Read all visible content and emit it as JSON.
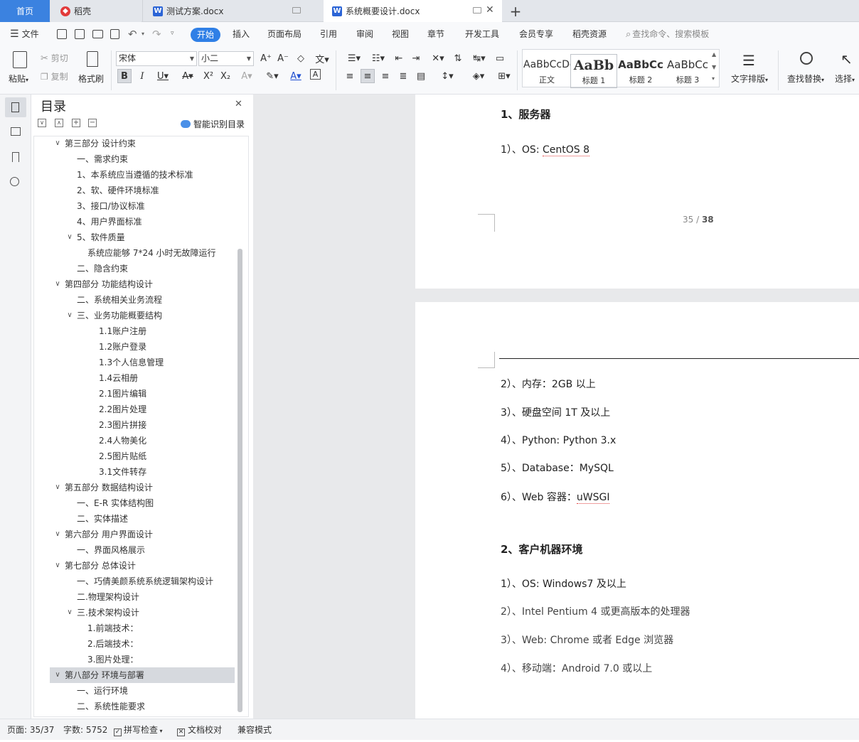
{
  "tabs": {
    "home": "首页",
    "daoke": "稻壳",
    "doc1": "测试方案.docx",
    "doc2": "系统概要设计.docx",
    "new_tab": "+"
  },
  "menu": {
    "file": "文件",
    "items": [
      "开始",
      "插入",
      "页面布局",
      "引用",
      "审阅",
      "视图",
      "章节",
      "开发工具",
      "会员专享",
      "稻壳资源"
    ],
    "search_placeholder": "查找命令、搜索模板"
  },
  "ribbon": {
    "paste": "粘贴",
    "cut": "剪切",
    "copy": "复制",
    "format_painter": "格式刷",
    "font_name": "宋体",
    "font_size": "小二",
    "styles": [
      {
        "sample": "AaBbCcDd",
        "name": "正文"
      },
      {
        "sample": "AaBb",
        "name": "标题 1"
      },
      {
        "sample": "AaBbCc",
        "name": "标题 2"
      },
      {
        "sample": "AaBbCc",
        "name": "标题 3"
      }
    ],
    "text_layout": "文字排版",
    "find_replace": "查找替换",
    "select": "选择"
  },
  "toc": {
    "title": "目录",
    "smart_label": "智能识别目录",
    "items": [
      {
        "text": "第三部分 设计约束",
        "level": 0,
        "chevron": "v",
        "selected": false
      },
      {
        "text": "一、需求约束",
        "level": 1,
        "chevron": "",
        "selected": false
      },
      {
        "text": "1、本系统应当遵循的技术标准",
        "level": 1,
        "chevron": "",
        "selected": false
      },
      {
        "text": "2、软、硬件环境标准",
        "level": 1,
        "chevron": "",
        "selected": false
      },
      {
        "text": "3、接口/协议标准",
        "level": 1,
        "chevron": "",
        "selected": false
      },
      {
        "text": "4、用户界面标准",
        "level": 1,
        "chevron": "",
        "selected": false
      },
      {
        "text": "5、软件质量",
        "level": 1,
        "chevron": "v",
        "selected": false
      },
      {
        "text": "系统应能够 7*24 小时无故障运行",
        "level": 2,
        "chevron": "",
        "selected": false
      },
      {
        "text": "二、隐含约束",
        "level": 1,
        "chevron": "",
        "selected": false
      },
      {
        "text": "第四部分 功能结构设计",
        "level": 0,
        "chevron": "v",
        "selected": false
      },
      {
        "text": "二、系统相关业务流程",
        "level": 1,
        "chevron": "",
        "selected": false
      },
      {
        "text": "三、业务功能概要结构",
        "level": 1,
        "chevron": "v",
        "selected": false
      },
      {
        "text": "1.1账户注册",
        "level": 3,
        "chevron": "",
        "selected": false
      },
      {
        "text": "1.2账户登录",
        "level": 3,
        "chevron": "",
        "selected": false
      },
      {
        "text": "1.3个人信息管理",
        "level": 3,
        "chevron": "",
        "selected": false
      },
      {
        "text": "1.4云相册",
        "level": 3,
        "chevron": "",
        "selected": false
      },
      {
        "text": "2.1图片编辑",
        "level": 3,
        "chevron": "",
        "selected": false
      },
      {
        "text": "2.2图片处理",
        "level": 3,
        "chevron": "",
        "selected": false
      },
      {
        "text": "2.3图片拼接",
        "level": 3,
        "chevron": "",
        "selected": false
      },
      {
        "text": "2.4人物美化",
        "level": 3,
        "chevron": "",
        "selected": false
      },
      {
        "text": "2.5图片贴纸",
        "level": 3,
        "chevron": "",
        "selected": false
      },
      {
        "text": "3.1文件转存",
        "level": 3,
        "chevron": "",
        "selected": false
      },
      {
        "text": "第五部分 数据结构设计",
        "level": 0,
        "chevron": "v",
        "selected": false
      },
      {
        "text": "一、E-R 实体结构图",
        "level": 1,
        "chevron": "",
        "selected": false
      },
      {
        "text": "二、实体描述",
        "level": 1,
        "chevron": "",
        "selected": false
      },
      {
        "text": "第六部分 用户界面设计",
        "level": 0,
        "chevron": "v",
        "selected": false
      },
      {
        "text": "一、界面风格展示",
        "level": 1,
        "chevron": "",
        "selected": false
      },
      {
        "text": "第七部分 总体设计",
        "level": 0,
        "chevron": "v",
        "selected": false
      },
      {
        "text": "一、巧倩美颜系统系统逻辑架构设计",
        "level": 1,
        "chevron": "",
        "selected": false
      },
      {
        "text": "二.物理架构设计",
        "level": 1,
        "chevron": "",
        "selected": false
      },
      {
        "text": "三.技术架构设计",
        "level": 1,
        "chevron": "v",
        "selected": false
      },
      {
        "text": "1.前端技术：",
        "level": 2,
        "chevron": "",
        "selected": false
      },
      {
        "text": "2.后端技术：",
        "level": 2,
        "chevron": "",
        "selected": false
      },
      {
        "text": "3.图片处理：",
        "level": 2,
        "chevron": "",
        "selected": false
      },
      {
        "text": "第八部分 环境与部署",
        "level": 0,
        "chevron": "v",
        "selected": true
      },
      {
        "text": "一、运行环境",
        "level": 1,
        "chevron": "",
        "selected": false
      },
      {
        "text": "二、系统性能要求",
        "level": 1,
        "chevron": "",
        "selected": false
      }
    ]
  },
  "document": {
    "page1": {
      "heading": "1、服务器",
      "line1_prefix": "1）、OS: ",
      "line1_word": "CentOS 8",
      "page_number": "35 / ",
      "page_total": "38"
    },
    "page2": {
      "lines": [
        "2）、内存：2GB 以上",
        "3）、硬盘空间 1T 及以上",
        "4）、Python: Python 3.x",
        "5）、Database：MySQL"
      ],
      "web_prefix": "6）、Web 容器：",
      "web_word": "uWSGI",
      "heading2": "2、客户机器环境",
      "client_lines": [
        "1）、OS: Windows7 及以上",
        "2）、Intel Pentium 4 或更高版本的处理器",
        "3）、Web: Chrome 或者 Edge 浏览器",
        "4）、移动端：Android 7.0 或以上"
      ]
    }
  },
  "status": {
    "page": "页面: 35/37",
    "words": "字数: 5752",
    "spell": "拼写检查",
    "proof": "文档校对",
    "compat": "兼容模式"
  },
  "colors": {
    "accent": "#2f7fe6",
    "home_tab": "#3b82e0",
    "daoke_red": "#e23a3a",
    "word_blue": "#2b64d6"
  }
}
